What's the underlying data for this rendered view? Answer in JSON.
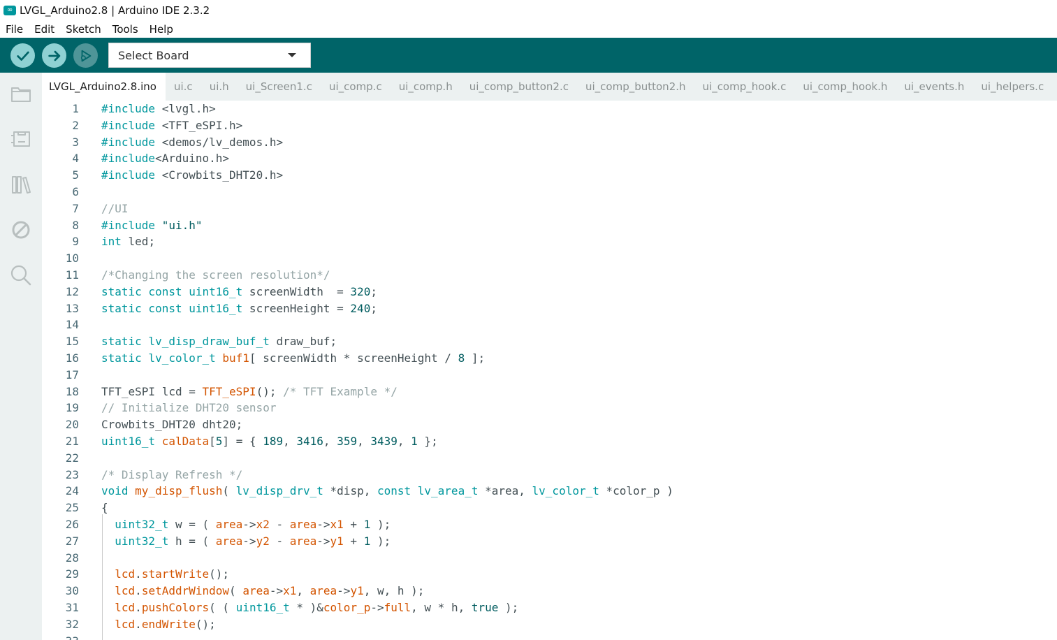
{
  "window": {
    "title": "LVGL_Arduino2.8 | Arduino IDE 2.3.2",
    "app_icon_glyph": "∞"
  },
  "menu": [
    "File",
    "Edit",
    "Sketch",
    "Tools",
    "Help"
  ],
  "toolbar": {
    "verify_icon": "check-icon",
    "upload_icon": "arrow-right-icon",
    "debug_icon": "debug-icon",
    "board_select_label": "Select Board"
  },
  "sidebar": {
    "items": [
      "folder-icon",
      "board-manager-icon",
      "library-icon",
      "debug-off-icon",
      "search-icon"
    ]
  },
  "tabs": [
    "LVGL_Arduino2.8.ino",
    "ui.c",
    "ui.h",
    "ui_Screen1.c",
    "ui_comp.c",
    "ui_comp.h",
    "ui_comp_button2.c",
    "ui_comp_button2.h",
    "ui_comp_hook.c",
    "ui_comp_hook.h",
    "ui_events.h",
    "ui_helpers.c"
  ],
  "active_tab": 0,
  "colors": {
    "toolbar": "#006468",
    "keyword": "#00979d",
    "function": "#d35400",
    "comment": "#95a5a6"
  },
  "code_lines": [
    [
      [
        "kw",
        "#include "
      ],
      [
        "tx",
        "<lvgl.h>"
      ]
    ],
    [
      [
        "kw",
        "#include "
      ],
      [
        "tx",
        "<TFT_eSPI.h>"
      ]
    ],
    [
      [
        "kw",
        "#include "
      ],
      [
        "tx",
        "<demos/lv_demos.h>"
      ]
    ],
    [
      [
        "kw",
        "#include"
      ],
      [
        "tx",
        "<Arduino.h>"
      ]
    ],
    [
      [
        "kw",
        "#include "
      ],
      [
        "tx",
        "<Crowbits_DHT20.h>"
      ]
    ],
    [],
    [
      [
        "cm",
        "//UI"
      ]
    ],
    [
      [
        "kw",
        "#include "
      ],
      [
        "st",
        "\"ui.h\""
      ]
    ],
    [
      [
        "kw",
        "int"
      ],
      [
        "tx",
        " led;"
      ]
    ],
    [],
    [
      [
        "cm",
        "/*Changing the screen resolution*/"
      ]
    ],
    [
      [
        "kw",
        "static const uint16_t"
      ],
      [
        "tx",
        " screenWidth  = "
      ],
      [
        "nm",
        "320"
      ],
      [
        "tx",
        ";"
      ]
    ],
    [
      [
        "kw",
        "static const uint16_t"
      ],
      [
        "tx",
        " screenHeight = "
      ],
      [
        "nm",
        "240"
      ],
      [
        "tx",
        ";"
      ]
    ],
    [],
    [
      [
        "kw",
        "static lv_disp_draw_buf_t"
      ],
      [
        "tx",
        " draw_buf;"
      ]
    ],
    [
      [
        "kw",
        "static lv_color_t"
      ],
      [
        "tx",
        " "
      ],
      [
        "fn",
        "buf1"
      ],
      [
        "tx",
        "[ screenWidth * screenHeight / "
      ],
      [
        "nm",
        "8"
      ],
      [
        "tx",
        " ];"
      ]
    ],
    [],
    [
      [
        "tx",
        "TFT_eSPI lcd = "
      ],
      [
        "fn",
        "TFT_eSPI"
      ],
      [
        "tx",
        "(); "
      ],
      [
        "cm",
        "/* TFT Example */"
      ]
    ],
    [
      [
        "cm",
        "// Initialize DHT20 sensor"
      ]
    ],
    [
      [
        "tx",
        "Crowbits_DHT20 dht20;"
      ]
    ],
    [
      [
        "kw",
        "uint16_t"
      ],
      [
        "tx",
        " "
      ],
      [
        "fn",
        "calData"
      ],
      [
        "tx",
        "["
      ],
      [
        "nm",
        "5"
      ],
      [
        "tx",
        "] = { "
      ],
      [
        "nm",
        "189"
      ],
      [
        "tx",
        ", "
      ],
      [
        "nm",
        "3416"
      ],
      [
        "tx",
        ", "
      ],
      [
        "nm",
        "359"
      ],
      [
        "tx",
        ", "
      ],
      [
        "nm",
        "3439"
      ],
      [
        "tx",
        ", "
      ],
      [
        "nm",
        "1"
      ],
      [
        "tx",
        " };"
      ]
    ],
    [],
    [
      [
        "cm",
        "/* Display Refresh */"
      ]
    ],
    [
      [
        "kw",
        "void"
      ],
      [
        "tx",
        " "
      ],
      [
        "fn",
        "my_disp_flush"
      ],
      [
        "tx",
        "( "
      ],
      [
        "kw",
        "lv_disp_drv_t"
      ],
      [
        "tx",
        " *disp, "
      ],
      [
        "kw",
        "const lv_area_t"
      ],
      [
        "tx",
        " *area, "
      ],
      [
        "kw",
        "lv_color_t"
      ],
      [
        "tx",
        " *color_p )"
      ]
    ],
    [
      [
        "tx",
        "{"
      ]
    ],
    [
      [
        "tx",
        "  "
      ],
      [
        "kw",
        "uint32_t"
      ],
      [
        "tx",
        " w = ( "
      ],
      [
        "fn",
        "area"
      ],
      [
        "tx",
        "->"
      ],
      [
        "fn",
        "x2"
      ],
      [
        "tx",
        " - "
      ],
      [
        "fn",
        "area"
      ],
      [
        "tx",
        "->"
      ],
      [
        "fn",
        "x1"
      ],
      [
        "tx",
        " + "
      ],
      [
        "nm",
        "1"
      ],
      [
        "tx",
        " );"
      ]
    ],
    [
      [
        "tx",
        "  "
      ],
      [
        "kw",
        "uint32_t"
      ],
      [
        "tx",
        " h = ( "
      ],
      [
        "fn",
        "area"
      ],
      [
        "tx",
        "->"
      ],
      [
        "fn",
        "y2"
      ],
      [
        "tx",
        " - "
      ],
      [
        "fn",
        "area"
      ],
      [
        "tx",
        "->"
      ],
      [
        "fn",
        "y1"
      ],
      [
        "tx",
        " + "
      ],
      [
        "nm",
        "1"
      ],
      [
        "tx",
        " );"
      ]
    ],
    [],
    [
      [
        "tx",
        "  "
      ],
      [
        "fn",
        "lcd"
      ],
      [
        "tx",
        "."
      ],
      [
        "fn",
        "startWrite"
      ],
      [
        "tx",
        "();"
      ]
    ],
    [
      [
        "tx",
        "  "
      ],
      [
        "fn",
        "lcd"
      ],
      [
        "tx",
        "."
      ],
      [
        "fn",
        "setAddrWindow"
      ],
      [
        "tx",
        "( "
      ],
      [
        "fn",
        "area"
      ],
      [
        "tx",
        "->"
      ],
      [
        "fn",
        "x1"
      ],
      [
        "tx",
        ", "
      ],
      [
        "fn",
        "area"
      ],
      [
        "tx",
        "->"
      ],
      [
        "fn",
        "y1"
      ],
      [
        "tx",
        ", w, h );"
      ]
    ],
    [
      [
        "tx",
        "  "
      ],
      [
        "fn",
        "lcd"
      ],
      [
        "tx",
        "."
      ],
      [
        "fn",
        "pushColors"
      ],
      [
        "tx",
        "( ( "
      ],
      [
        "kw",
        "uint16_t"
      ],
      [
        "tx",
        " * )&"
      ],
      [
        "fn",
        "color_p"
      ],
      [
        "tx",
        "->"
      ],
      [
        "fn",
        "full"
      ],
      [
        "tx",
        ", w * h, "
      ],
      [
        "st",
        "true"
      ],
      [
        "tx",
        " );"
      ]
    ],
    [
      [
        "tx",
        "  "
      ],
      [
        "fn",
        "lcd"
      ],
      [
        "tx",
        "."
      ],
      [
        "fn",
        "endWrite"
      ],
      [
        "tx",
        "();"
      ]
    ],
    []
  ]
}
